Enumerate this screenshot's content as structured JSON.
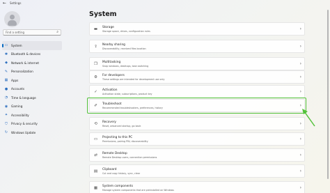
{
  "window": {
    "title": "Settings",
    "back_glyph": "←"
  },
  "sidebar": {
    "search_placeholder": "Find a setting",
    "search_icon": "search-icon",
    "items": [
      {
        "label": "System",
        "icon": "monitor-icon",
        "glyph": "▭",
        "active": true
      },
      {
        "label": "Bluetooth & devices",
        "icon": "bluetooth-icon",
        "glyph": "✱"
      },
      {
        "label": "Network & internet",
        "icon": "network-icon",
        "glyph": "◆"
      },
      {
        "label": "Personalization",
        "icon": "brush-icon",
        "glyph": "✎"
      },
      {
        "label": "Apps",
        "icon": "apps-icon",
        "glyph": "▦"
      },
      {
        "label": "Accounts",
        "icon": "person-icon",
        "glyph": "●"
      },
      {
        "label": "Time & language",
        "icon": "globe-clock-icon",
        "glyph": "◔"
      },
      {
        "label": "Gaming",
        "icon": "controller-icon",
        "glyph": "◉"
      },
      {
        "label": "Accessibility",
        "icon": "accessibility-icon",
        "glyph": "✦"
      },
      {
        "label": "Privacy & security",
        "icon": "shield-icon",
        "glyph": "⛉"
      },
      {
        "label": "Windows Update",
        "icon": "update-icon",
        "glyph": "↻"
      }
    ]
  },
  "main": {
    "title": "System",
    "cards": [
      {
        "title": "Storage",
        "subtitle": "Storage space, drives, configuration rules",
        "icon": "storage-icon",
        "glyph": "▬"
      },
      {
        "title": "Nearby sharing",
        "subtitle": "Discoverability, received files location",
        "icon": "share-icon",
        "glyph": "⇪"
      },
      {
        "title": "Multitasking",
        "subtitle": "Snap windows, desktops, task switching",
        "icon": "multitask-icon",
        "glyph": "❐"
      },
      {
        "title": "For developers",
        "subtitle": "These settings are intended for development use only",
        "icon": "developer-icon",
        "glyph": "⚙"
      },
      {
        "title": "Activation",
        "subtitle": "Activation state, subscriptions, product key",
        "icon": "activation-icon",
        "glyph": "✓"
      },
      {
        "title": "Troubleshoot",
        "subtitle": "Recommended troubleshooters, preferences, history",
        "icon": "wrench-icon",
        "glyph": "✐"
      },
      {
        "title": "Recovery",
        "subtitle": "Reset, advanced startup, go back",
        "icon": "recovery-icon",
        "glyph": "⟲"
      },
      {
        "title": "Projecting to this PC",
        "subtitle": "Permissions, pairing PIN, discoverability",
        "icon": "projector-icon",
        "glyph": "▭"
      },
      {
        "title": "Remote Desktop",
        "subtitle": "Remote Desktop users, connection permissions",
        "icon": "remote-desktop-icon",
        "glyph": "⇄"
      },
      {
        "title": "Clipboard",
        "subtitle": "Cut and copy history, sync, clear",
        "icon": "clipboard-icon",
        "glyph": "▤"
      },
      {
        "title": "System components",
        "subtitle": "Manage system components that are preinstalled on Windows",
        "icon": "components-icon",
        "glyph": "▦"
      }
    ],
    "chevron": "›"
  },
  "colors": {
    "accent": "#0067c0",
    "highlight": "#53c23a"
  }
}
